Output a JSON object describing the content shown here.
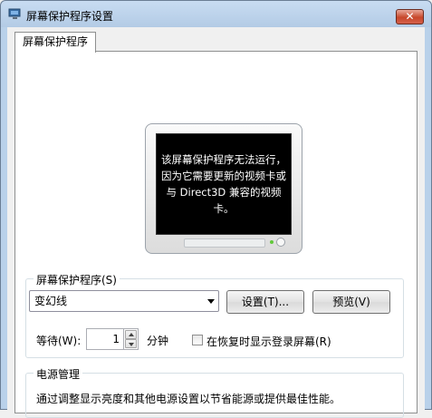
{
  "window": {
    "title": "屏幕保护程序设置",
    "close_label": "✕"
  },
  "tab": {
    "label": "屏幕保护程序"
  },
  "preview": {
    "message": "该屏幕保护程序无法运行，因为它需要更新的视频卡或与 Direct3D 兼容的视频卡。"
  },
  "screensaver_group": {
    "label": "屏幕保护程序(S)",
    "selected_value": "变幻线",
    "settings_button": "设置(T)...",
    "preview_button": "预览(V)",
    "wait_label": "等待(W):",
    "wait_value": "1",
    "wait_unit": "分钟",
    "logon_checkbox_label": "在恢复时显示登录屏幕(R)",
    "logon_checked": false
  },
  "power_group": {
    "label": "电源管理",
    "description": "通过调整显示亮度和其他电源设置以节省能源或提供最佳性能。"
  }
}
